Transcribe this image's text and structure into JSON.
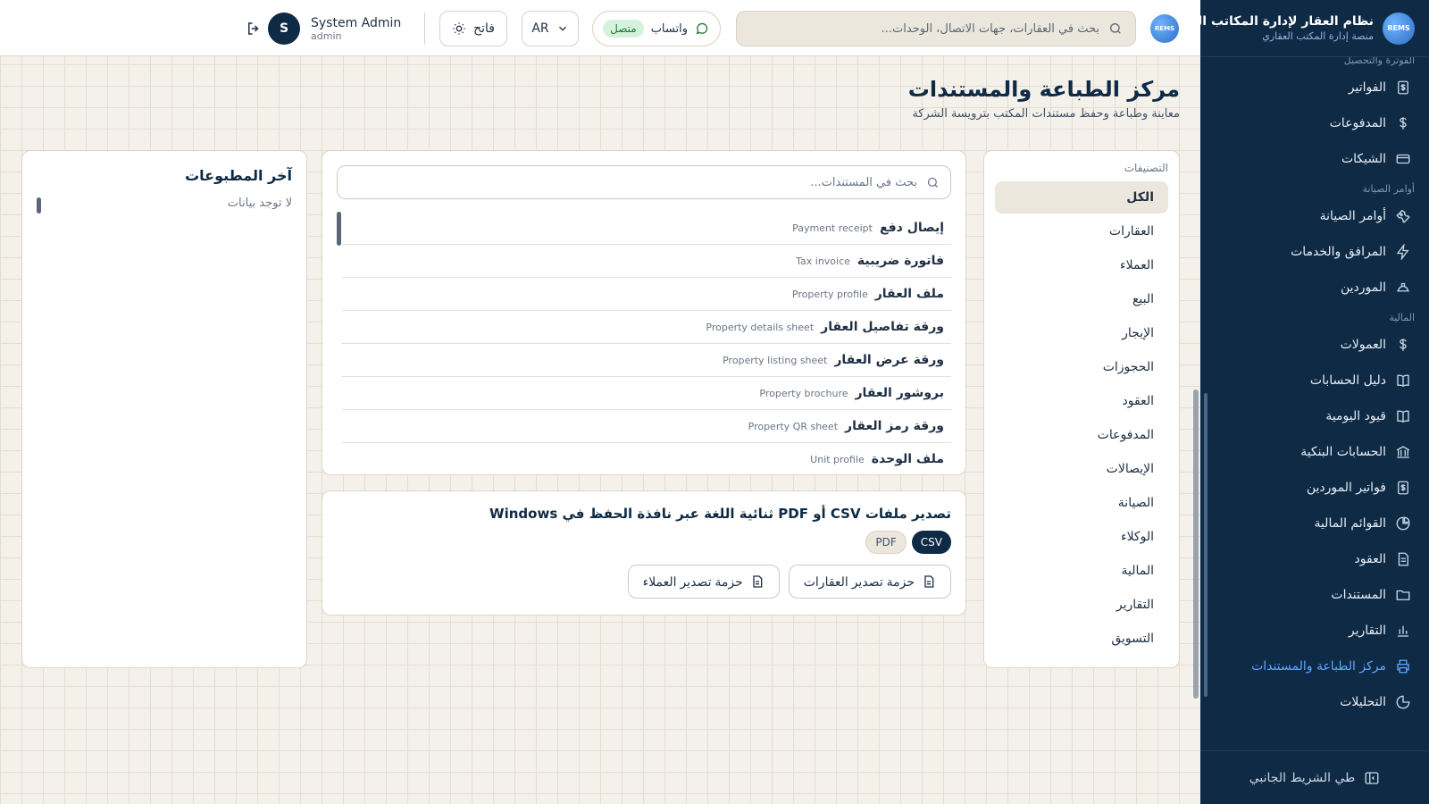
{
  "brand": {
    "logo_text": "REMS",
    "title": "نظام العقار لإدارة المكاتب العقارية",
    "subtitle": "منصة إدارة المكتب العقاري"
  },
  "sidebar": {
    "cut_section": "الفوترة والتحصيل",
    "items_top": [
      {
        "label": "الفواتير",
        "icon": "invoice-dollar-icon"
      },
      {
        "label": "المدفوعات",
        "icon": "dollar-icon"
      },
      {
        "label": "الشيكات",
        "icon": "card-icon"
      }
    ],
    "section_maintenance": "أوامر الصيانة",
    "items_maintenance": [
      {
        "label": "أوامر الصيانة",
        "icon": "wrench-icon"
      },
      {
        "label": "المرافق والخدمات",
        "icon": "bolt-icon"
      },
      {
        "label": "الموردين",
        "icon": "hard-hat-icon"
      }
    ],
    "section_finance": "المالية",
    "items_finance": [
      {
        "label": "العمولات",
        "icon": "dollar-icon"
      },
      {
        "label": "دليل الحسابات",
        "icon": "book-icon"
      },
      {
        "label": "قيود اليومية",
        "icon": "book-icon"
      },
      {
        "label": "الحسابات البنكية",
        "icon": "bank-icon"
      },
      {
        "label": "فواتير الموردين",
        "icon": "invoice-dollar-icon"
      },
      {
        "label": "القوائم المالية",
        "icon": "pie-chart-icon"
      },
      {
        "label": "العقود",
        "icon": "file-icon"
      },
      {
        "label": "المستندات",
        "icon": "folder-icon"
      },
      {
        "label": "التقارير",
        "icon": "bar-chart-icon"
      },
      {
        "label": "مركز الطباعة والمستندات",
        "icon": "printer-icon"
      },
      {
        "label": "التحليلات",
        "icon": "pie-chart-icon"
      }
    ],
    "active_label": "مركز الطباعة والمستندات",
    "collapse_label": "طي الشريط الجانبي"
  },
  "topbar": {
    "search_placeholder": "بحث في العقارات، جهات الاتصال، الوحدات...",
    "whatsapp_label": "واتساب",
    "whatsapp_status": "متصل",
    "lang_label": "AR",
    "theme_label": "فاتح",
    "user_initial": "S",
    "user_name": "System Admin",
    "user_role": "admin"
  },
  "page": {
    "title": "مركز الطباعة والمستندات",
    "subtitle": "معاينة وطباعة وحفظ مستندات المكتب بترويسة الشركة"
  },
  "categories": {
    "title": "التصنيفات",
    "items": [
      "الكل",
      "العقارات",
      "العملاء",
      "البيع",
      "الإيجار",
      "الحجوزات",
      "العقود",
      "المدفوعات",
      "الإيصالات",
      "الصيانة",
      "الوكلاء",
      "المالية",
      "التقارير",
      "التسويق"
    ],
    "active": "الكل"
  },
  "documents": {
    "search_placeholder": "بحث في المستندات...",
    "rows": [
      {
        "ar": "إيصال دفع",
        "en": "Payment receipt"
      },
      {
        "ar": "فاتورة ضريبية",
        "en": "Tax invoice"
      },
      {
        "ar": "ملف العقار",
        "en": "Property profile"
      },
      {
        "ar": "ورقة تفاصيل العقار",
        "en": "Property details sheet"
      },
      {
        "ar": "ورقة عرض العقار",
        "en": "Property listing sheet"
      },
      {
        "ar": "بروشور العقار",
        "en": "Property brochure"
      },
      {
        "ar": "ورقة رمز العقار",
        "en": "Property QR sheet"
      },
      {
        "ar": "ملف الوحدة",
        "en": "Unit profile"
      }
    ]
  },
  "export": {
    "title": "تصدير ملفات CSV أو PDF ثنائية اللغة عبر نافذة الحفظ في Windows",
    "formats": [
      "CSV",
      "PDF"
    ],
    "active_format": "CSV",
    "pack_properties": "حزمة تصدير العقارات",
    "pack_clients": "حزمة تصدير العملاء"
  },
  "recent": {
    "title": "آخر المطبوعات",
    "empty": "لا توجد بيانات"
  },
  "colors": {
    "sidebar_bg": "#0f2a45",
    "accent": "#5ea8ff",
    "page_bg": "#f4f1ea",
    "status_green": "#1f7a38"
  }
}
